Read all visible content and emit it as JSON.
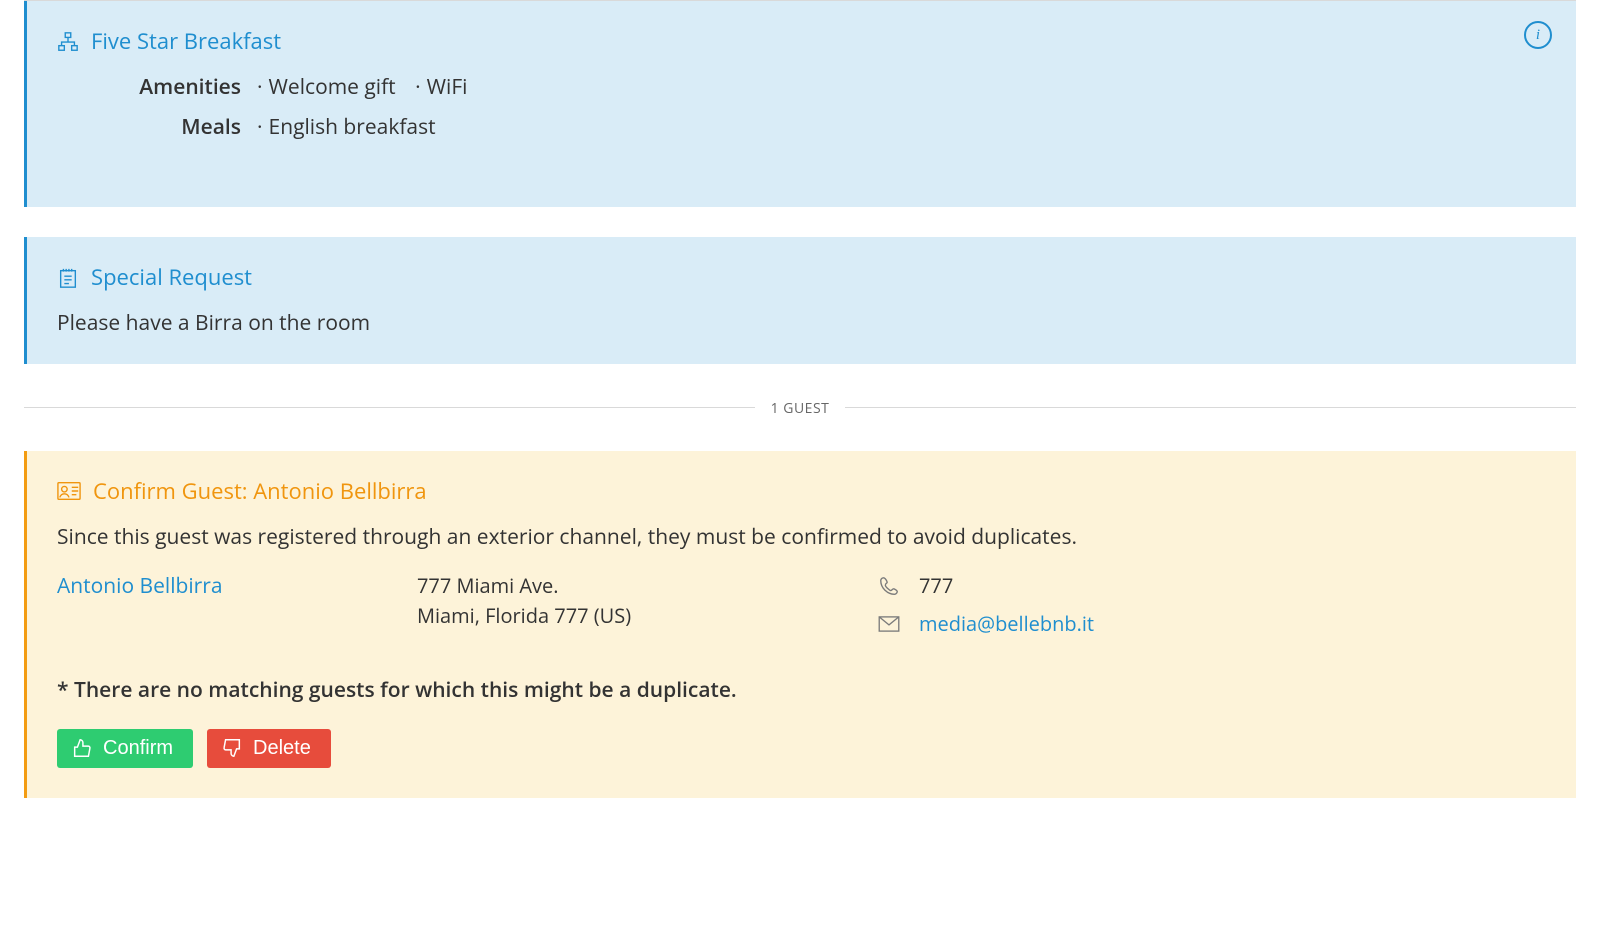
{
  "breakfast": {
    "title": "Five Star Breakfast",
    "rows": [
      {
        "label": "Amenities",
        "items": [
          "Welcome gift",
          "WiFi"
        ]
      },
      {
        "label": "Meals",
        "items": [
          "English breakfast"
        ]
      }
    ]
  },
  "request": {
    "title": "Special Request",
    "text": "Please have a Birra on the room"
  },
  "guestDivider": "1 GUEST",
  "confirm": {
    "title": "Confirm Guest: Antonio Bellbirra",
    "intro": "Since this guest was registered through an exterior channel, they must be confirmed to avoid duplicates.",
    "name": "Antonio Bellbirra",
    "addr1": "777 Miami Ave.",
    "addr2": "Miami, Florida 777 (US)",
    "phone": "777",
    "email": "media@bellebnb.it",
    "note": "* There are no matching guests for which this might be a duplicate.",
    "confirmBtn": "Confirm",
    "deleteBtn": "Delete"
  }
}
